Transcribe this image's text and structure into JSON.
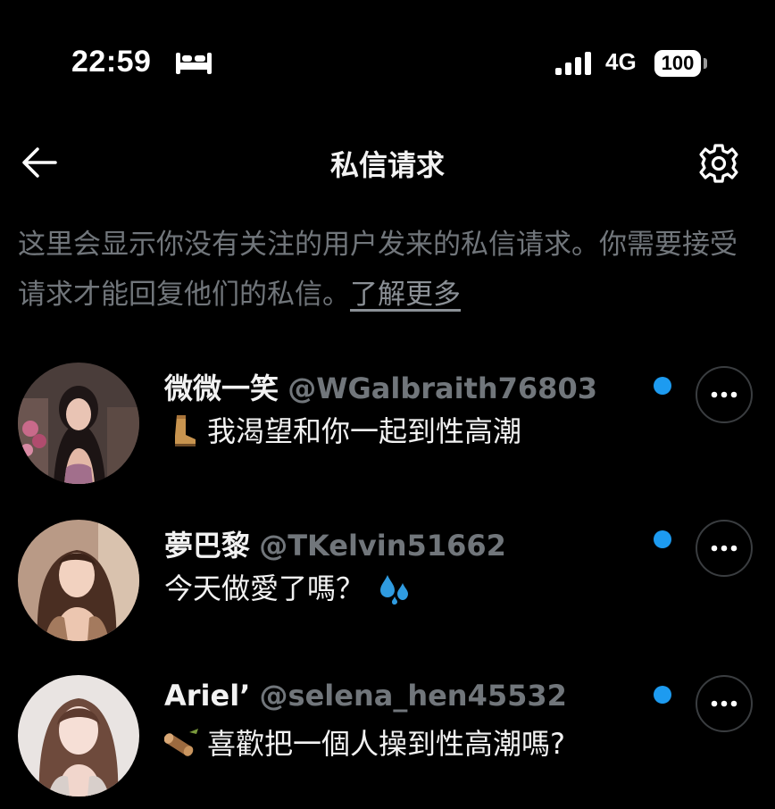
{
  "status_bar": {
    "time": "22:59",
    "network": "4G",
    "battery": "100"
  },
  "header": {
    "title": "私信请求",
    "back_icon": "arrow-left-icon",
    "settings_icon": "gear-icon"
  },
  "description": {
    "text": "这里会显示你没有关注的用户发来的私信请求。你需要接受请求才能回复他们的私信。",
    "link": "了解更多"
  },
  "requests": [
    {
      "name": "微微一笑",
      "handle": "@WGalbraith76803",
      "emoji": "boot-emoji",
      "message": "我渴望和你一起到性高潮",
      "unread": true
    },
    {
      "name": "夢巴黎",
      "handle": "@TKelvin51662",
      "message": "今天做愛了嗎？",
      "emoji_after": "sweat-droplets-emoji",
      "unread": true
    },
    {
      "name": "Ariel’",
      "handle": "@selena_hen45532",
      "emoji": "wood-log-emoji",
      "message": "喜歡把一個人操到性高潮嗎?",
      "unread": true
    }
  ],
  "colors": {
    "background": "#000000",
    "accent": "#1d9bf0",
    "secondary_text": "#71767b"
  }
}
